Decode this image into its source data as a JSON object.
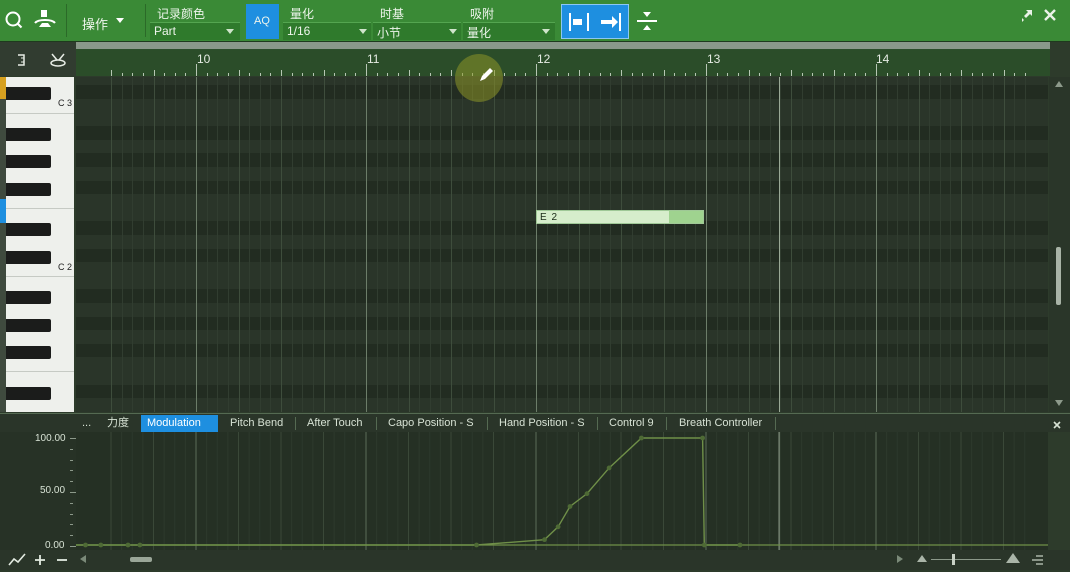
{
  "toolbar": {
    "ops_label": "操作",
    "record_color": {
      "label": "记录颜色",
      "value": "Part"
    },
    "aq_label": "AQ",
    "quantize": {
      "label": "量化",
      "value": "1/16"
    },
    "timebase": {
      "label": "时基",
      "value": "小节"
    },
    "snap": {
      "label": "吸附",
      "value": "量化"
    }
  },
  "ruler": {
    "bars": [
      "10",
      "11",
      "12",
      "13",
      "14"
    ]
  },
  "piano": {
    "labels": [
      "C 3",
      "C 2"
    ]
  },
  "note": {
    "label": "E 2"
  },
  "lanes": {
    "more": "...",
    "tabs": [
      "力度",
      "Modulation",
      "Pitch Bend",
      "After Touch",
      "Capo Position - S",
      "Hand Position - S",
      "Control 9",
      "Breath Controller"
    ],
    "active_index": 1
  },
  "ctrl_axis": {
    "labels": [
      "100.00",
      "50.00",
      "0.00"
    ]
  },
  "colors": {
    "toolbar": "#3a8a36",
    "accent": "#1e8fe0",
    "grid_bg": "#283327",
    "note": "#d6edcb",
    "curve": "#6f8f48"
  },
  "icons": [
    "search-icon",
    "metronome-icon",
    "pencil-icon",
    "close-icon",
    "expand-icon",
    "snap-start-icon",
    "snap-arrow-icon",
    "split-icon",
    "add-icon",
    "remove-icon",
    "curve-icon"
  ]
}
